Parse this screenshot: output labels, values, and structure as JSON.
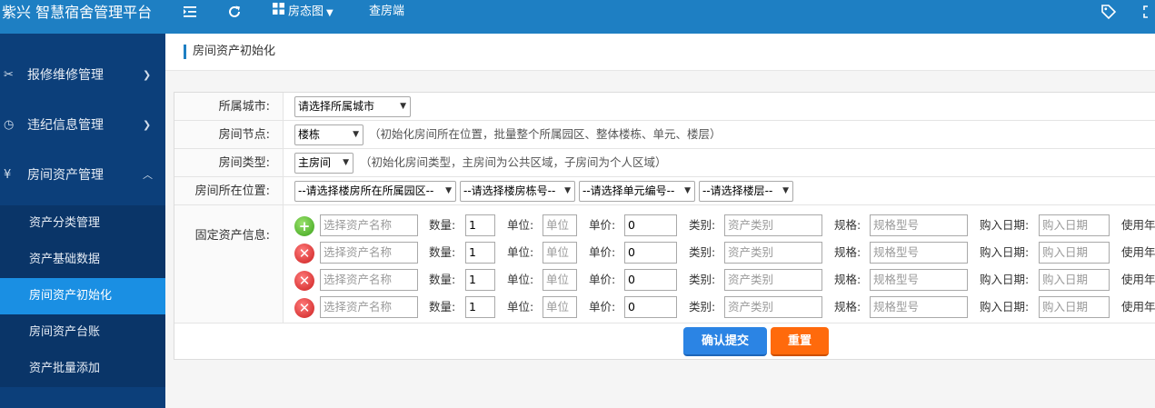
{
  "header": {
    "brand": "紫兴 智慧宿舍管理平台",
    "nav_fangtai": "房态图",
    "nav_chafang": "查房端",
    "icons": [
      "menu-indent-icon",
      "refresh-icon",
      "grid-icon",
      "tag-icon",
      "fullscreen-icon"
    ]
  },
  "sidebar": {
    "groups": [
      {
        "label": "报修维修管理",
        "icon": "tools-icon"
      },
      {
        "label": "违纪信息管理",
        "icon": "clock-icon"
      },
      {
        "label": "房间资产管理",
        "icon": "yen-icon"
      }
    ],
    "subitems": [
      {
        "label": "资产分类管理"
      },
      {
        "label": "资产基础数据"
      },
      {
        "label": "房间资产初始化",
        "active": true
      },
      {
        "label": "房间资产台账"
      },
      {
        "label": "资产批量添加"
      }
    ]
  },
  "breadcrumb": "房间资产初始化",
  "form": {
    "city_label": "所属城市:",
    "city_value": "请选择所属城市",
    "node_label": "房间节点:",
    "node_value": "楼栋",
    "node_hint": "（初始化房间所在位置，批量整个所属园区、整体楼栋、单元、楼层）",
    "type_label": "房间类型:",
    "type_value": "主房间",
    "type_hint": "（初始化房间类型，主房间为公共区域，子房间为个人区域）",
    "location_label": "房间所在位置:",
    "location_selects": [
      "--请选择楼房所在所属园区--",
      "--请选择楼房栋号--",
      "--请选择单元编号--",
      "--请选择楼层--"
    ],
    "assets_label": "固定资产信息:",
    "asset_field_labels": {
      "qty": "数量:",
      "unit": "单位:",
      "price": "单价:",
      "category": "类别:",
      "spec": "规格:",
      "date": "购入日期:",
      "use_year": "使用年"
    },
    "asset_placeholders": {
      "name": "选择资产名称",
      "unit": "单位",
      "category": "资产类别",
      "spec": "规格型号",
      "date": "购入日期"
    },
    "asset_rows": [
      {
        "action": "add",
        "qty": "1",
        "price": "0"
      },
      {
        "action": "delete",
        "qty": "1",
        "price": "0"
      },
      {
        "action": "delete",
        "qty": "1",
        "price": "0"
      },
      {
        "action": "delete",
        "qty": "1",
        "price": "0"
      }
    ]
  },
  "buttons": {
    "submit": "确认提交",
    "reset": "重置"
  },
  "colors": {
    "topbar": "#1e7fc3",
    "sidebar": "#0c3f7a",
    "active_item": "#1a8fe3",
    "submit": "#2b84e4",
    "reset": "#ff6a0c"
  }
}
